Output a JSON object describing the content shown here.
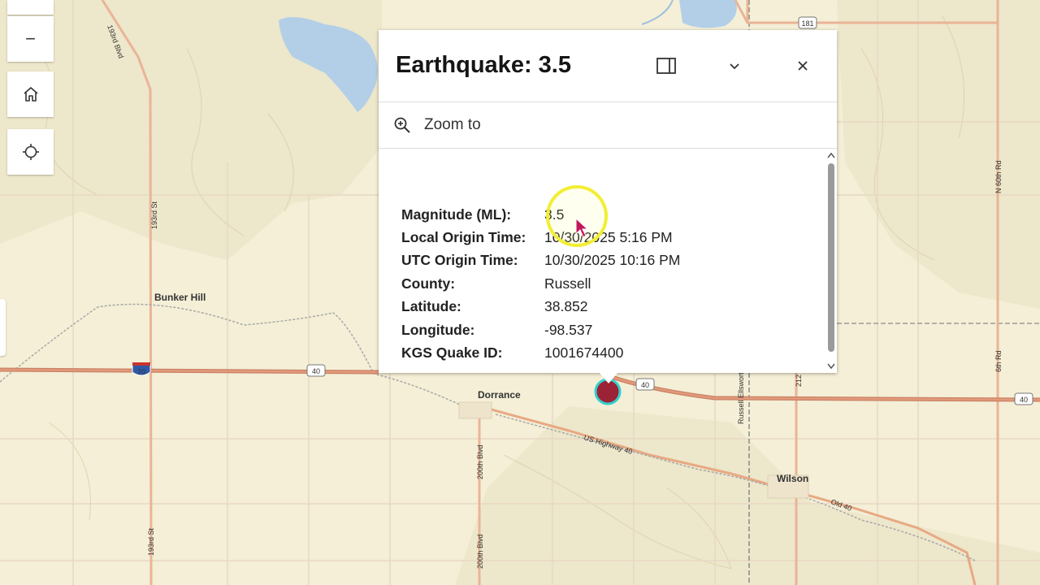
{
  "map": {
    "place_labels": [
      "Bunker Hill",
      "Dorrance",
      "Wilson"
    ],
    "road_labels": [
      "193rd Blvd",
      "193rd St",
      "193rd St",
      "200th Blvd",
      "200th Blvd",
      "US Highway 40",
      "Old 40",
      "Russell Ellsworth",
      "N 60th Rd",
      "6th Rd",
      "212"
    ],
    "shields": [
      "70",
      "40",
      "40",
      "40",
      "181"
    ],
    "colors": {
      "background": "#f4efd6",
      "water": "#b3cfe8",
      "road": "#e7a984",
      "interstate": "#c98165",
      "quake_marker": "#9b2335",
      "marker_ring": "#33d0cf"
    }
  },
  "toolbar": {
    "zoom_out": "−",
    "home_icon": "home-icon",
    "locate_icon": "locate-icon"
  },
  "popup": {
    "title": "Earthquake: 3.5",
    "zoom_to": "Zoom to",
    "attributes": [
      {
        "name": "Magnitude (ML):",
        "value": "3.5"
      },
      {
        "name": "Local Origin Time:",
        "value": "10/30/2025 5:16 PM"
      },
      {
        "name": "UTC Origin Time:",
        "value": "10/30/2025 10:16 PM"
      },
      {
        "name": "County:",
        "value": "Russell"
      },
      {
        "name": "Latitude:",
        "value": "38.852"
      },
      {
        "name": "Longitude:",
        "value": "-98.537"
      },
      {
        "name": "KGS Quake ID:",
        "value": "1001674400"
      }
    ]
  }
}
